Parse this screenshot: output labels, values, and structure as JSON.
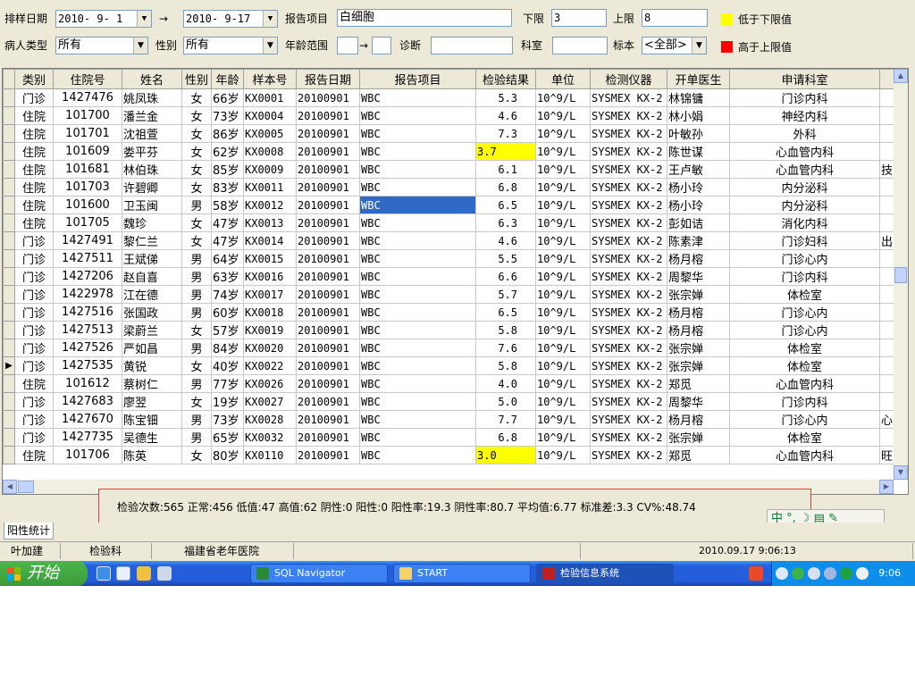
{
  "filters": {
    "sort_date_label": "排样日期",
    "date_from": "2010- 9- 1",
    "arrow": "→",
    "date_to": "2010- 9-17",
    "report_item_label": "报告项目",
    "report_item_value": "白细胞",
    "lower_label": "下限",
    "lower_value": "3",
    "upper_label": "上限",
    "upper_value": "8",
    "below_lower_legend": "低于下限值",
    "above_upper_legend": "高于上限值",
    "below_color": "#ffff00",
    "above_color": "#ff0000",
    "patient_type_label": "病人类型",
    "patient_type_value": "所有",
    "sex_label": "性别",
    "sex_value": "所有",
    "age_range_label": "年龄范围",
    "age_arrow": "→",
    "diagnosis_label": "诊断",
    "department_label": "科室",
    "specimen_label": "标本",
    "specimen_value": "<全部>"
  },
  "grid": {
    "columns": [
      "类别",
      "住院号",
      "姓名",
      "性别",
      "年龄",
      "样本号",
      "报告日期",
      "报告项目",
      "检验结果",
      "单位",
      "检测仪器",
      "开单医生",
      "申请科室",
      ""
    ],
    "rows": [
      {
        "type": "门诊",
        "id": "1427476",
        "name": "姚凤珠",
        "sex": "女",
        "age": "66岁",
        "sample": "KX0001",
        "date": "20100901",
        "item": "WBC",
        "result": "5.3",
        "unit": "10^9/L",
        "instrument": "SYSMEX KX-2",
        "doctor": "林锦镛",
        "dept": "门诊内科",
        "extra": "",
        "flag": "normal"
      },
      {
        "type": "住院",
        "id": "101700",
        "name": "潘兰金",
        "sex": "女",
        "age": "73岁",
        "sample": "KX0004",
        "date": "20100901",
        "item": "WBC",
        "result": "4.6",
        "unit": "10^9/L",
        "instrument": "SYSMEX KX-2",
        "doctor": "林小娟",
        "dept": "神经内科",
        "extra": "",
        "flag": "normal"
      },
      {
        "type": "住院",
        "id": "101701",
        "name": "沈祖萱",
        "sex": "女",
        "age": "86岁",
        "sample": "KX0005",
        "date": "20100901",
        "item": "WBC",
        "result": "7.3",
        "unit": "10^9/L",
        "instrument": "SYSMEX KX-2",
        "doctor": "叶敏孙",
        "dept": "外科",
        "extra": "",
        "flag": "normal"
      },
      {
        "type": "住院",
        "id": "101609",
        "name": "娄平芬",
        "sex": "女",
        "age": "62岁",
        "sample": "KX0008",
        "date": "20100901",
        "item": "WBC",
        "result": "3.7",
        "unit": "10^9/L",
        "instrument": "SYSMEX KX-2",
        "doctor": "陈世谋",
        "dept": "心血管内科",
        "extra": "",
        "flag": "low"
      },
      {
        "type": "住院",
        "id": "101681",
        "name": "林伯珠",
        "sex": "女",
        "age": "85岁",
        "sample": "KX0009",
        "date": "20100901",
        "item": "WBC",
        "result": "6.1",
        "unit": "10^9/L",
        "instrument": "SYSMEX KX-2",
        "doctor": "王卢敏",
        "dept": "心血管内科",
        "extra": "技",
        "flag": "normal"
      },
      {
        "type": "住院",
        "id": "101703",
        "name": "许碧卿",
        "sex": "女",
        "age": "83岁",
        "sample": "KX0011",
        "date": "20100901",
        "item": "WBC",
        "result": "6.8",
        "unit": "10^9/L",
        "instrument": "SYSMEX KX-2",
        "doctor": "杨小玲",
        "dept": "内分泌科",
        "extra": "",
        "flag": "normal"
      },
      {
        "type": "住院",
        "id": "101600",
        "name": "卫玉闽",
        "sex": "男",
        "age": "58岁",
        "sample": "KX0012",
        "date": "20100901",
        "item": "WBC",
        "result": "6.5",
        "unit": "10^9/L",
        "instrument": "SYSMEX KX-2",
        "doctor": "杨小玲",
        "dept": "内分泌科",
        "extra": "",
        "flag": "selected"
      },
      {
        "type": "住院",
        "id": "101705",
        "name": "魏珍",
        "sex": "女",
        "age": "47岁",
        "sample": "KX0013",
        "date": "20100901",
        "item": "WBC",
        "result": "6.3",
        "unit": "10^9/L",
        "instrument": "SYSMEX KX-2",
        "doctor": "彭如诘",
        "dept": "消化内科",
        "extra": "",
        "flag": "normal"
      },
      {
        "type": "门诊",
        "id": "1427491",
        "name": "黎仁兰",
        "sex": "女",
        "age": "47岁",
        "sample": "KX0014",
        "date": "20100901",
        "item": "WBC",
        "result": "4.6",
        "unit": "10^9/L",
        "instrument": "SYSMEX KX-2",
        "doctor": "陈素津",
        "dept": "门诊妇科",
        "extra": "出",
        "flag": "normal"
      },
      {
        "type": "门诊",
        "id": "1427511",
        "name": "王斌俤",
        "sex": "男",
        "age": "64岁",
        "sample": "KX0015",
        "date": "20100901",
        "item": "WBC",
        "result": "5.5",
        "unit": "10^9/L",
        "instrument": "SYSMEX KX-2",
        "doctor": "杨月榕",
        "dept": "门诊心内",
        "extra": "",
        "flag": "normal"
      },
      {
        "type": "门诊",
        "id": "1427206",
        "name": "赵自喜",
        "sex": "男",
        "age": "63岁",
        "sample": "KX0016",
        "date": "20100901",
        "item": "WBC",
        "result": "6.6",
        "unit": "10^9/L",
        "instrument": "SYSMEX KX-2",
        "doctor": "周黎华",
        "dept": "门诊内科",
        "extra": "",
        "flag": "normal"
      },
      {
        "type": "门诊",
        "id": "1422978",
        "name": "江在德",
        "sex": "男",
        "age": "74岁",
        "sample": "KX0017",
        "date": "20100901",
        "item": "WBC",
        "result": "5.7",
        "unit": "10^9/L",
        "instrument": "SYSMEX KX-2",
        "doctor": "张宗婵",
        "dept": "体检室",
        "extra": "",
        "flag": "normal"
      },
      {
        "type": "门诊",
        "id": "1427516",
        "name": "张国政",
        "sex": "男",
        "age": "60岁",
        "sample": "KX0018",
        "date": "20100901",
        "item": "WBC",
        "result": "6.5",
        "unit": "10^9/L",
        "instrument": "SYSMEX KX-2",
        "doctor": "杨月榕",
        "dept": "门诊心内",
        "extra": "",
        "flag": "normal"
      },
      {
        "type": "门诊",
        "id": "1427513",
        "name": "梁蔚兰",
        "sex": "女",
        "age": "57岁",
        "sample": "KX0019",
        "date": "20100901",
        "item": "WBC",
        "result": "5.8",
        "unit": "10^9/L",
        "instrument": "SYSMEX KX-2",
        "doctor": "杨月榕",
        "dept": "门诊心内",
        "extra": "",
        "flag": "normal"
      },
      {
        "type": "门诊",
        "id": "1427526",
        "name": "严如昌",
        "sex": "男",
        "age": "84岁",
        "sample": "KX0020",
        "date": "20100901",
        "item": "WBC",
        "result": "7.6",
        "unit": "10^9/L",
        "instrument": "SYSMEX KX-2",
        "doctor": "张宗婵",
        "dept": "体检室",
        "extra": "",
        "flag": "normal"
      },
      {
        "type": "门诊",
        "id": "1427535",
        "name": "黄锐",
        "sex": "女",
        "age": "40岁",
        "sample": "KX0022",
        "date": "20100901",
        "item": "WBC",
        "result": "5.8",
        "unit": "10^9/L",
        "instrument": "SYSMEX KX-2",
        "doctor": "张宗婵",
        "dept": "体检室",
        "extra": "",
        "flag": "normal",
        "current": true
      },
      {
        "type": "住院",
        "id": "101612",
        "name": "蔡树仁",
        "sex": "男",
        "age": "77岁",
        "sample": "KX0026",
        "date": "20100901",
        "item": "WBC",
        "result": "4.0",
        "unit": "10^9/L",
        "instrument": "SYSMEX KX-2",
        "doctor": "郑觅",
        "dept": "心血管内科",
        "extra": "",
        "flag": "normal"
      },
      {
        "type": "门诊",
        "id": "1427683",
        "name": "廖翌",
        "sex": "女",
        "age": "19岁",
        "sample": "KX0027",
        "date": "20100901",
        "item": "WBC",
        "result": "5.0",
        "unit": "10^9/L",
        "instrument": "SYSMEX KX-2",
        "doctor": "周黎华",
        "dept": "门诊内科",
        "extra": "",
        "flag": "normal"
      },
      {
        "type": "门诊",
        "id": "1427670",
        "name": "陈宝钿",
        "sex": "男",
        "age": "73岁",
        "sample": "KX0028",
        "date": "20100901",
        "item": "WBC",
        "result": "7.7",
        "unit": "10^9/L",
        "instrument": "SYSMEX KX-2",
        "doctor": "杨月榕",
        "dept": "门诊心内",
        "extra": "心",
        "flag": "normal"
      },
      {
        "type": "门诊",
        "id": "1427735",
        "name": "吴德生",
        "sex": "男",
        "age": "65岁",
        "sample": "KX0032",
        "date": "20100901",
        "item": "WBC",
        "result": "6.8",
        "unit": "10^9/L",
        "instrument": "SYSMEX KX-2",
        "doctor": "张宗婵",
        "dept": "体检室",
        "extra": "",
        "flag": "normal"
      },
      {
        "type": "住院",
        "id": "101706",
        "name": "陈英",
        "sex": "女",
        "age": "80岁",
        "sample": "KX0110",
        "date": "20100901",
        "item": "WBC",
        "result": "3.0",
        "unit": "10^9/L",
        "instrument": "SYSMEX KX-2",
        "doctor": "郑觅",
        "dept": "心血管内科",
        "extra": "旺",
        "flag": "low"
      }
    ]
  },
  "stats": {
    "text": "检验次数:565 正常:456 低值:47 高值:62 阴性:0 阳性:0 阳性率:19.3 阴性率:80.7 平均值:6.77 标准差:3.3 CV%:48.74"
  },
  "ime": {
    "text": "中 °, ☽ ▤ ✎",
    "icon": "ime-toolbar-icon"
  },
  "tabs": {
    "positive_stats": "阳性统计"
  },
  "statusbar": {
    "user": "叶加建",
    "dept": "检验科",
    "hospital": "福建省老年医院",
    "datetime": "2010.09.17 9:06:13"
  },
  "taskbar": {
    "start_label": "开始",
    "tasks": [
      {
        "label": "SQL Navigator",
        "icon": "globe-icon"
      },
      {
        "label": "START",
        "icon": "folder-icon"
      },
      {
        "label": "检验信息系统",
        "icon": "app-icon",
        "active": true
      }
    ],
    "clock": "9:06"
  }
}
